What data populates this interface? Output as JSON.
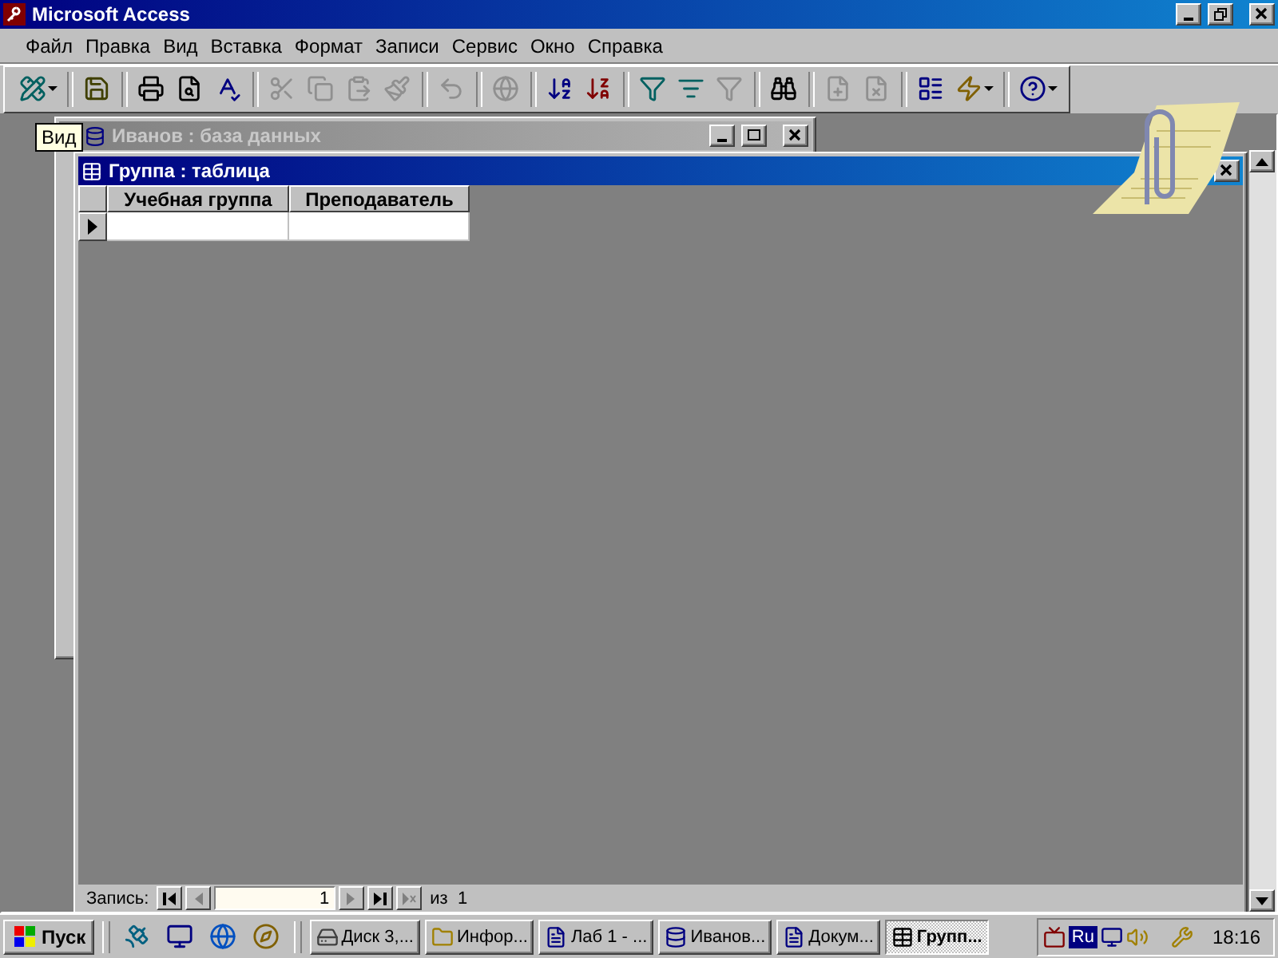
{
  "window": {
    "title": "Microsoft Access"
  },
  "menu": [
    "Файл",
    "Правка",
    "Вид",
    "Вставка",
    "Формат",
    "Записи",
    "Сервис",
    "Окно",
    "Справка"
  ],
  "toolbar": [
    {
      "kind": "design",
      "disabled": false,
      "dropdown": true
    },
    {
      "kind": "separator"
    },
    {
      "kind": "save",
      "disabled": false
    },
    {
      "kind": "separator"
    },
    {
      "kind": "print",
      "disabled": false
    },
    {
      "kind": "preview",
      "disabled": false
    },
    {
      "kind": "spelling",
      "disabled": false
    },
    {
      "kind": "separator"
    },
    {
      "kind": "cut",
      "disabled": true
    },
    {
      "kind": "copy",
      "disabled": true
    },
    {
      "kind": "paste",
      "disabled": true
    },
    {
      "kind": "painter",
      "disabled": true
    },
    {
      "kind": "separator"
    },
    {
      "kind": "undo",
      "disabled": true
    },
    {
      "kind": "separator"
    },
    {
      "kind": "hyperlink",
      "disabled": true
    },
    {
      "kind": "separator"
    },
    {
      "kind": "sortasc",
      "disabled": false
    },
    {
      "kind": "sortdesc",
      "disabled": false
    },
    {
      "kind": "separator"
    },
    {
      "kind": "filtersel",
      "disabled": false
    },
    {
      "kind": "filterform",
      "disabled": false
    },
    {
      "kind": "filter",
      "disabled": true
    },
    {
      "kind": "separator"
    },
    {
      "kind": "find",
      "disabled": false
    },
    {
      "kind": "separator"
    },
    {
      "kind": "newrec",
      "disabled": true
    },
    {
      "kind": "delrec",
      "disabled": true
    },
    {
      "kind": "separator"
    },
    {
      "kind": "dbwindow",
      "disabled": false
    },
    {
      "kind": "newobject",
      "disabled": false,
      "dropdown": true
    },
    {
      "kind": "separator"
    },
    {
      "kind": "help",
      "disabled": false,
      "dropdown": true
    }
  ],
  "tooltip": "Вид",
  "db_window": {
    "title": "Иванов : база данных",
    "active": false
  },
  "table_window": {
    "title": "Группа : таблица",
    "active": true,
    "columns": [
      "Учебная группа",
      "Преподаватель"
    ],
    "rows": [
      {
        "current": true,
        "cells": [
          "",
          ""
        ]
      }
    ],
    "navigation": {
      "label": "Запись:",
      "record": "1",
      "total": "из  1"
    }
  },
  "taskbar": {
    "start": "Пуск",
    "quick_launch": [
      {
        "kind": "network"
      },
      {
        "kind": "desktop"
      },
      {
        "kind": "browser"
      },
      {
        "kind": "channels"
      }
    ],
    "tasks": [
      {
        "label": "Диск 3,...",
        "kind": "drive",
        "selected": false
      },
      {
        "label": "Инфор...",
        "kind": "folder",
        "selected": false
      },
      {
        "label": "Лаб 1 - ...",
        "kind": "document",
        "selected": false
      },
      {
        "label": "Иванов...",
        "kind": "database",
        "selected": false
      },
      {
        "label": "Докум...",
        "kind": "document",
        "selected": false
      },
      {
        "label": "Групп...",
        "kind": "table",
        "selected": true
      }
    ],
    "language": "Ru",
    "clock": "18:16"
  }
}
